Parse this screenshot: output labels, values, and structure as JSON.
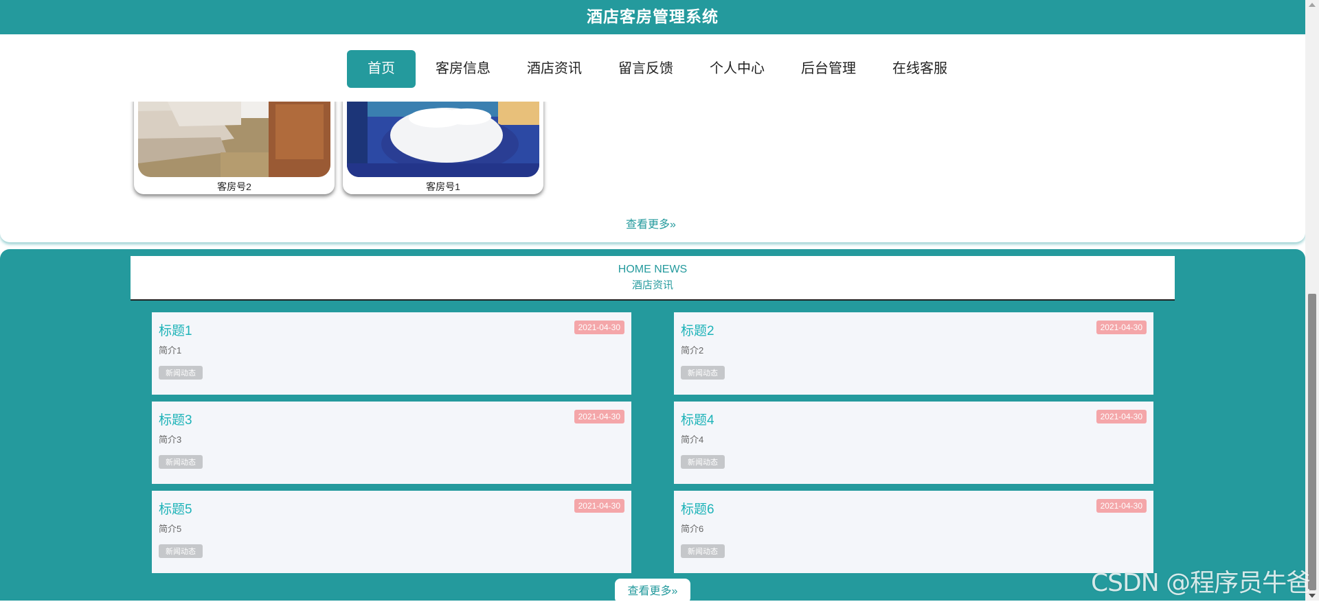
{
  "header": {
    "title": "酒店客房管理系统"
  },
  "nav": {
    "items": [
      {
        "label": "首页",
        "active": true
      },
      {
        "label": "客房信息"
      },
      {
        "label": "酒店资讯"
      },
      {
        "label": "留言反馈"
      },
      {
        "label": "个人中心"
      },
      {
        "label": "后台管理"
      },
      {
        "label": "在线客服"
      }
    ]
  },
  "rooms": {
    "items": [
      {
        "name": "客房号2"
      },
      {
        "name": "客房号1"
      }
    ],
    "more_label": "查看更多»"
  },
  "news": {
    "heading_en": "HOME NEWS",
    "heading_cn": "酒店资讯",
    "items": [
      {
        "title": "标题1",
        "date": "2021-04-30",
        "intro": "简介1",
        "tag": "新闻动态"
      },
      {
        "title": "标题2",
        "date": "2021-04-30",
        "intro": "简介2",
        "tag": "新闻动态"
      },
      {
        "title": "标题3",
        "date": "2021-04-30",
        "intro": "简介3",
        "tag": "新闻动态"
      },
      {
        "title": "标题4",
        "date": "2021-04-30",
        "intro": "简介4",
        "tag": "新闻动态"
      },
      {
        "title": "标题5",
        "date": "2021-04-30",
        "intro": "简介5",
        "tag": "新闻动态"
      },
      {
        "title": "标题6",
        "date": "2021-04-30",
        "intro": "简介6",
        "tag": "新闻动态"
      }
    ],
    "more_label": "查看更多»"
  },
  "watermark": "CSDN @程序员牛爸",
  "colors": {
    "primary": "#249a9d",
    "news_title": "#1eb3b8",
    "date_badge": "#f4a6a9"
  }
}
